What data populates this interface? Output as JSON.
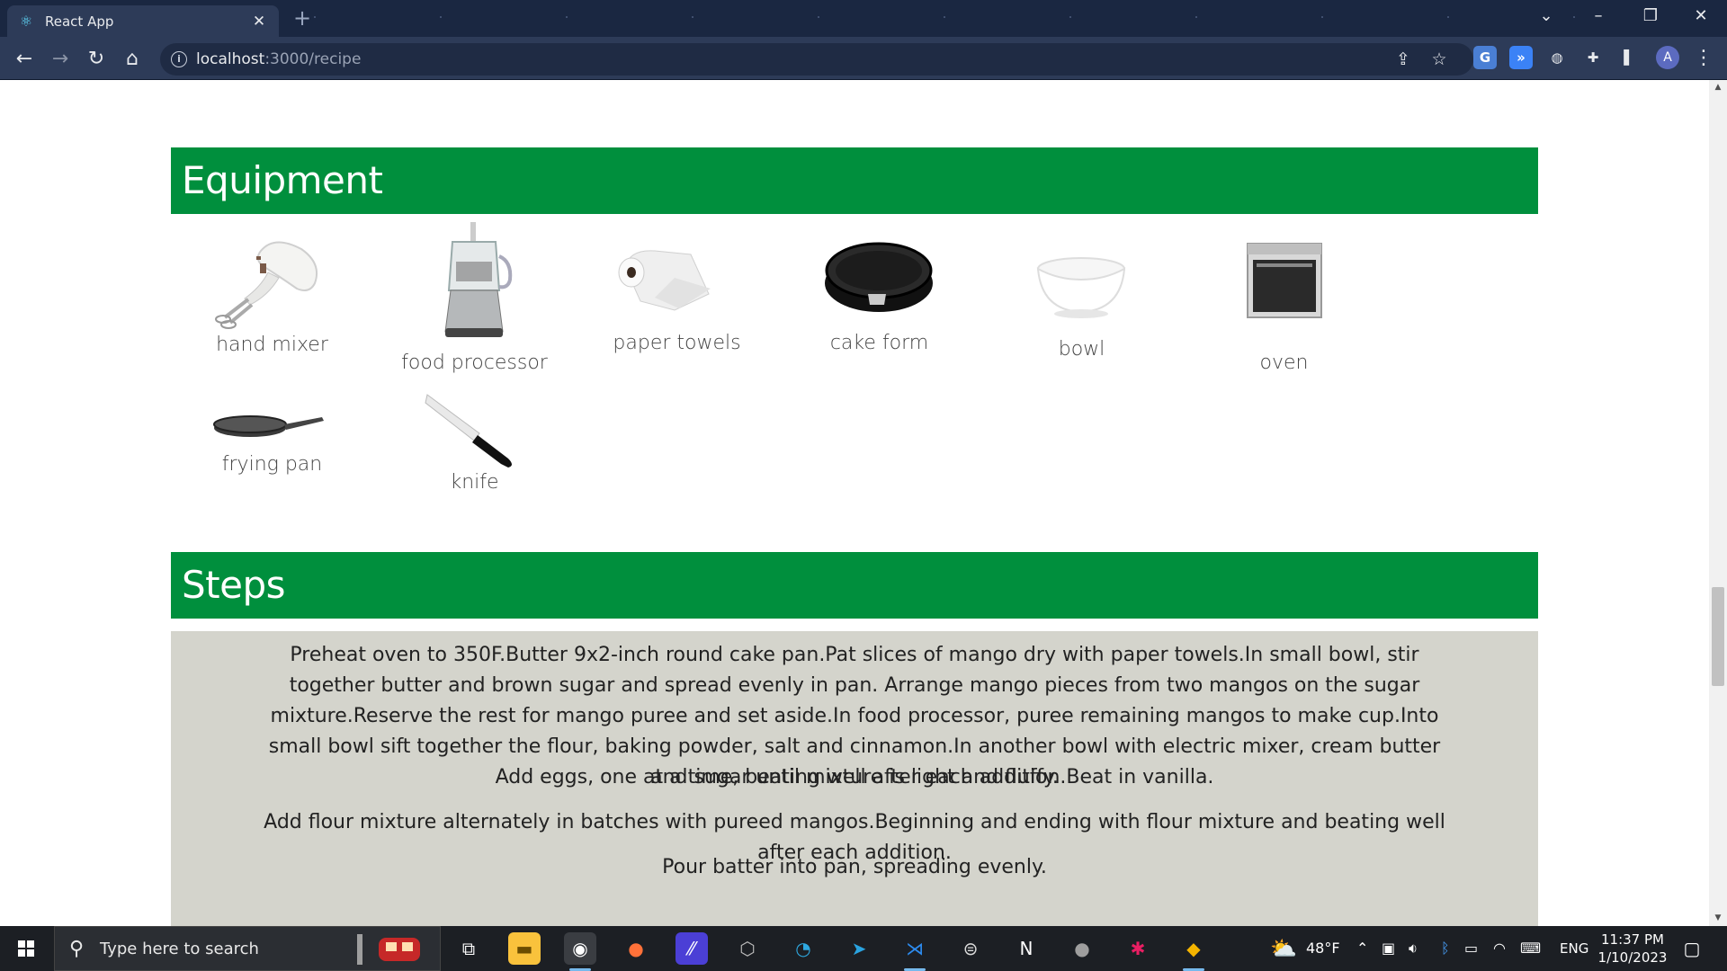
{
  "browser": {
    "tab_title": "React App",
    "tab_close": "✕",
    "new_tab": "+",
    "url_host": "localhost",
    "url_path": ":3000/recipe",
    "profile_initial": "A",
    "window_controls": {
      "chevron": "⌄",
      "minimize": "–",
      "restore": "❐",
      "close": "✕"
    }
  },
  "page": {
    "equipment_heading": "Equipment",
    "equipment": [
      {
        "label": "hand mixer",
        "icon": "hand-mixer"
      },
      {
        "label": "food processor",
        "icon": "food-processor"
      },
      {
        "label": "paper towels",
        "icon": "paper-towels"
      },
      {
        "label": "cake form",
        "icon": "cake-form"
      },
      {
        "label": "bowl",
        "icon": "bowl"
      },
      {
        "label": "oven",
        "icon": "oven"
      },
      {
        "label": "frying pan",
        "icon": "frying-pan"
      },
      {
        "label": "knife",
        "icon": "knife"
      }
    ],
    "steps_heading": "Steps",
    "steps": [
      "Preheat oven to 350F.Butter 9x2-inch round cake pan.Pat slices of mango dry with paper towels.In small bowl, stir together butter and brown sugar and spread evenly in pan. Arrange mango pieces from two mangos on the sugar mixture.Reserve the rest for mango puree and set aside.In food processor, puree remaining mangos to make cup.Into small bowl sift together the flour, baking powder, salt and cinnamon.In another bowl with electric mixer, cream butter and sugar until mixture is light and fluffy.",
      "Add eggs, one at a time, beating well after each addition.Beat in vanilla.",
      "Add flour mixture alternately in batches with pureed mangos.Beginning and ending with flour mixture and beating well after each addition.",
      "Pour batter into pan, spreading evenly."
    ]
  },
  "taskbar": {
    "search_placeholder": "Type here to search",
    "weather_temp": "48°F",
    "language": "ENG",
    "time": "11:37 PM",
    "date": "1/10/2023"
  },
  "colors": {
    "section_header": "#008f3d",
    "steps_background": "#d4d4cc",
    "chrome_dark": "#1a2741",
    "chrome_toolbar": "#2d3b58"
  }
}
